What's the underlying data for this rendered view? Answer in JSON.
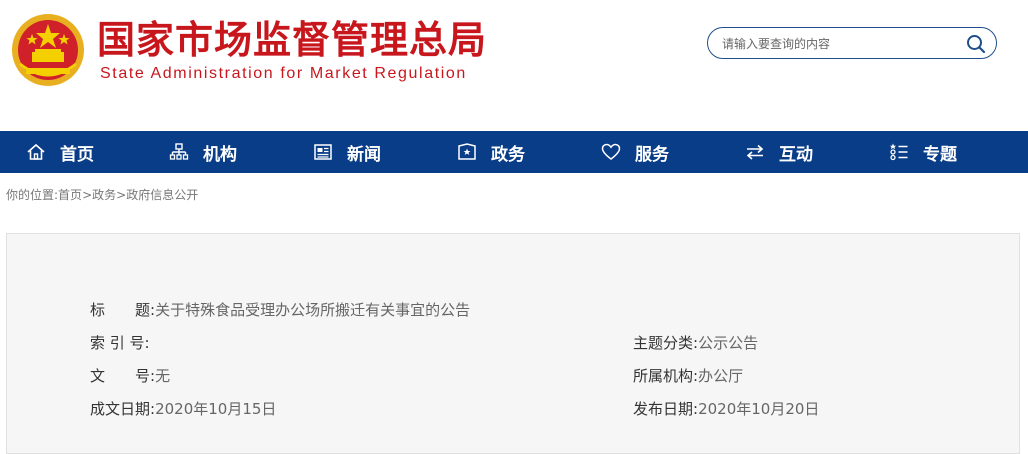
{
  "header": {
    "title_cn": "国家市场监督管理总局",
    "title_en": "State Administration for Market Regulation",
    "emblem_icon": "national-emblem-icon"
  },
  "search": {
    "placeholder": "请输入要查询的内容",
    "value": "",
    "icon": "search-icon"
  },
  "nav": {
    "items": [
      {
        "label": "首页",
        "icon": "home-icon"
      },
      {
        "label": "机构",
        "icon": "org-chart-icon"
      },
      {
        "label": "新闻",
        "icon": "news-icon"
      },
      {
        "label": "政务",
        "icon": "government-affairs-icon"
      },
      {
        "label": "服务",
        "icon": "heart-icon"
      },
      {
        "label": "互动",
        "icon": "exchange-arrows-icon"
      },
      {
        "label": "专题",
        "icon": "topics-list-icon"
      }
    ]
  },
  "breadcrumb": {
    "prefix": "你的位置:",
    "items": [
      "首页",
      "政务",
      "政府信息公开"
    ],
    "separator": ">"
  },
  "info": {
    "title_label": "标　　题:",
    "title_value": "关于特殊食品受理办公场所搬迁有关事宜的公告",
    "index_label": "索 引 号:",
    "index_value": "",
    "doc_label": "文　　号:",
    "doc_value": "无",
    "date_label": "成文日期:",
    "date_value": "2020年10月15日",
    "topic_label": "主题分类:",
    "topic_value": "公示公告",
    "agency_label": "所属机构:",
    "agency_value": "办公厅",
    "publish_label": "发布日期:",
    "publish_value": "2020年10月20日"
  },
  "colors": {
    "brand_red": "#c8161d",
    "nav_blue": "#0a3d87",
    "search_border": "#1f4e8c"
  }
}
